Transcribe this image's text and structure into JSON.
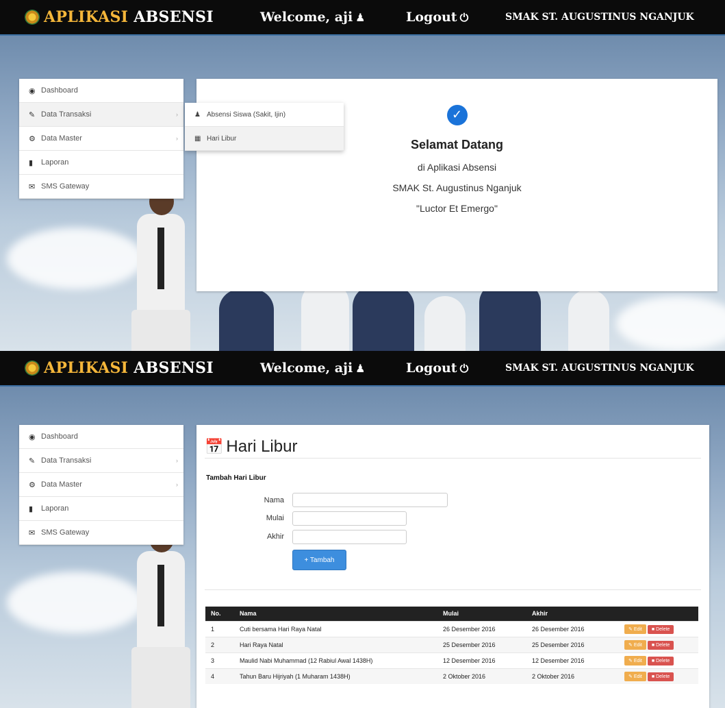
{
  "navbar": {
    "brand_part1": "APLIKASI",
    "brand_part2": "ABSENSI",
    "welcome": "Welcome, aji",
    "user_icon": "user-icon",
    "logout": "Logout",
    "power_icon": "power-icon",
    "school": "SMAK ST. AUGUSTINUS NGANJUK"
  },
  "sidebar": {
    "items": [
      {
        "label": "Dashboard",
        "icon": "dashboard-icon"
      },
      {
        "label": "Data Transaksi",
        "icon": "edit-icon"
      },
      {
        "label": "Data Master",
        "icon": "gear-icon"
      },
      {
        "label": "Laporan",
        "icon": "book-icon"
      },
      {
        "label": "SMS Gateway",
        "icon": "envelope-icon"
      }
    ]
  },
  "submenu": {
    "items": [
      {
        "label": "Absensi Siswa (Sakit, Ijin)",
        "icon": "user-icon"
      },
      {
        "label": "Hari Libur",
        "icon": "calendar-icon"
      }
    ]
  },
  "welcome_card": {
    "title": "Selamat Datang",
    "line1": "di Aplikasi Absensi",
    "line2": "SMAK St. Augustinus Nganjuk",
    "line3": "\"Luctor Et Emergo\""
  },
  "hari_libur": {
    "title": "Hari Libur",
    "form_title": "Tambah Hari Libur",
    "label_nama": "Nama",
    "label_mulai": "Mulai",
    "label_akhir": "Akhir",
    "button_tambah": "+ Tambah",
    "table": {
      "headers": [
        "No.",
        "Nama",
        "Mulai",
        "Akhir",
        ""
      ],
      "rows": [
        {
          "no": "1",
          "nama": "Cuti bersama Hari Raya Natal",
          "mulai": "26 Desember 2016",
          "akhir": "26 Desember 2016"
        },
        {
          "no": "2",
          "nama": "Hari Raya Natal",
          "mulai": "25 Desember 2016",
          "akhir": "25 Desember 2016"
        },
        {
          "no": "3",
          "nama": "Maulid Nabi Muhammad (12 Rabiul Awal 1438H)",
          "mulai": "12 Desember 2016",
          "akhir": "12 Desember 2016"
        },
        {
          "no": "4",
          "nama": "Tahun Baru Hijriyah (1 Muharam 1438H)",
          "mulai": "2 Oktober 2016",
          "akhir": "2 Oktober 2016"
        }
      ],
      "edit_label": "Edit",
      "delete_label": "Delete"
    }
  }
}
